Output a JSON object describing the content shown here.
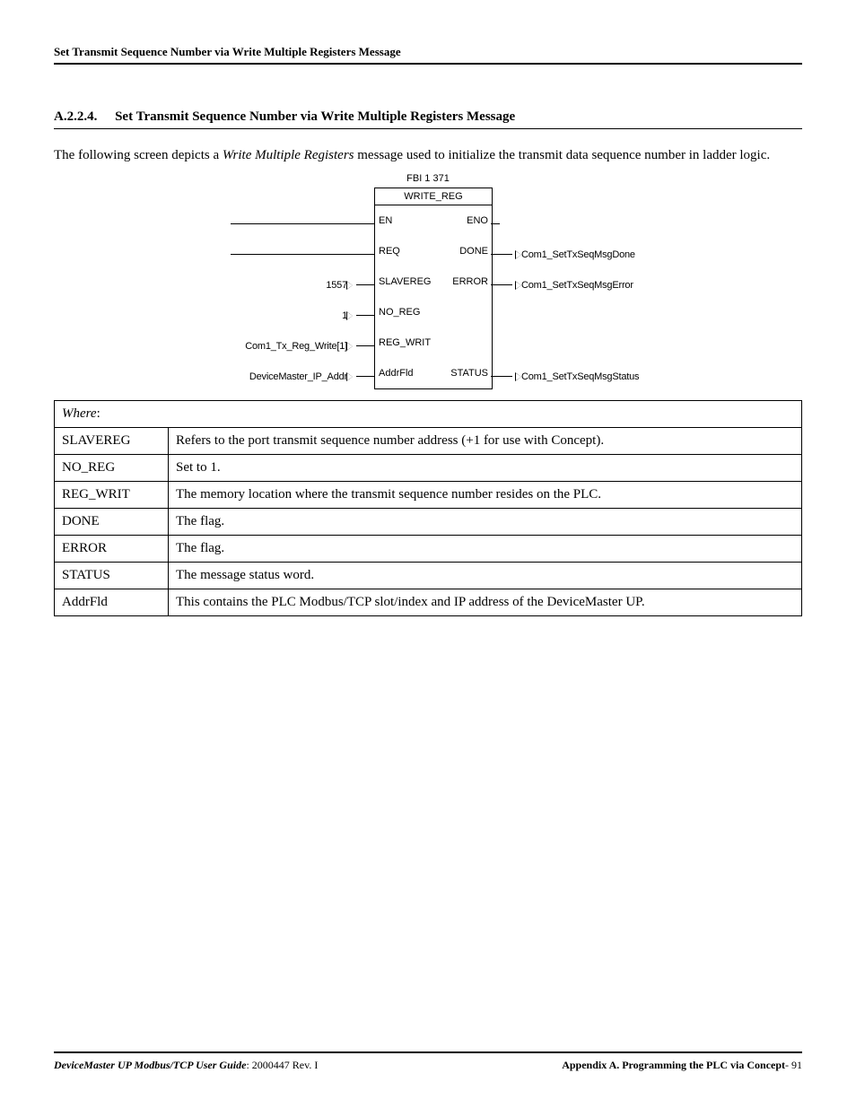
{
  "runningHead": "Set Transmit Sequence Number via Write Multiple Registers Message",
  "section": {
    "number": "A.2.2.4.",
    "title": "Set Transmit Sequence Number via Write Multiple Registers Message"
  },
  "intro": {
    "pre": "The following screen depicts a ",
    "em": "Write Multiple Registers",
    "post": " message used to initialize the transmit data sequence number in ladder logic."
  },
  "figure": {
    "blockLabel": "FBI 1 371",
    "blockType": "WRITE_REG",
    "pins": {
      "en": "EN",
      "eno": "ENO",
      "req": "REQ",
      "done": "DONE",
      "slavereg": "SLAVEREG",
      "error": "ERROR",
      "no_reg": "NO_REG",
      "reg_writ": "REG_WRIT",
      "addrfld": "AddrFld",
      "status": "STATUS"
    },
    "leftInputs": {
      "slavereg_val": "1557",
      "no_reg_val": "1",
      "reg_writ_src": "Com1_Tx_Reg_Write[1]",
      "addrfld_src": "DeviceMaster_IP_Addr"
    },
    "rightOutputs": {
      "done_dst": "Com1_SetTxSeqMsgDone",
      "error_dst": "Com1_SetTxSeqMsgError",
      "status_dst": "Com1_SetTxSeqMsgStatus"
    }
  },
  "defs": {
    "whereLabel": "Where",
    "rows": [
      {
        "term": "SLAVEREG",
        "desc": "Refers to the port transmit sequence number address (+1 for use with Concept)."
      },
      {
        "term": "NO_REG",
        "desc": "Set to 1."
      },
      {
        "term": "REG_WRIT",
        "desc": "The memory location where the transmit sequence number resides on the PLC."
      },
      {
        "term": "DONE",
        "desc": "The          flag."
      },
      {
        "term": "ERROR",
        "desc": "The          flag."
      },
      {
        "term": "STATUS",
        "desc": "The message status word."
      },
      {
        "term": "AddrFld",
        "desc": "This contains the PLC Modbus/TCP slot/index and IP address of the DeviceMaster UP."
      }
    ]
  },
  "footer": {
    "leftEm": "DeviceMaster UP Modbus/TCP User Guide",
    "leftRest": ": 2000447 Rev. I",
    "rightBold": "Appendix A. Programming the PLC via Concept",
    "rightRest": "- 91"
  }
}
